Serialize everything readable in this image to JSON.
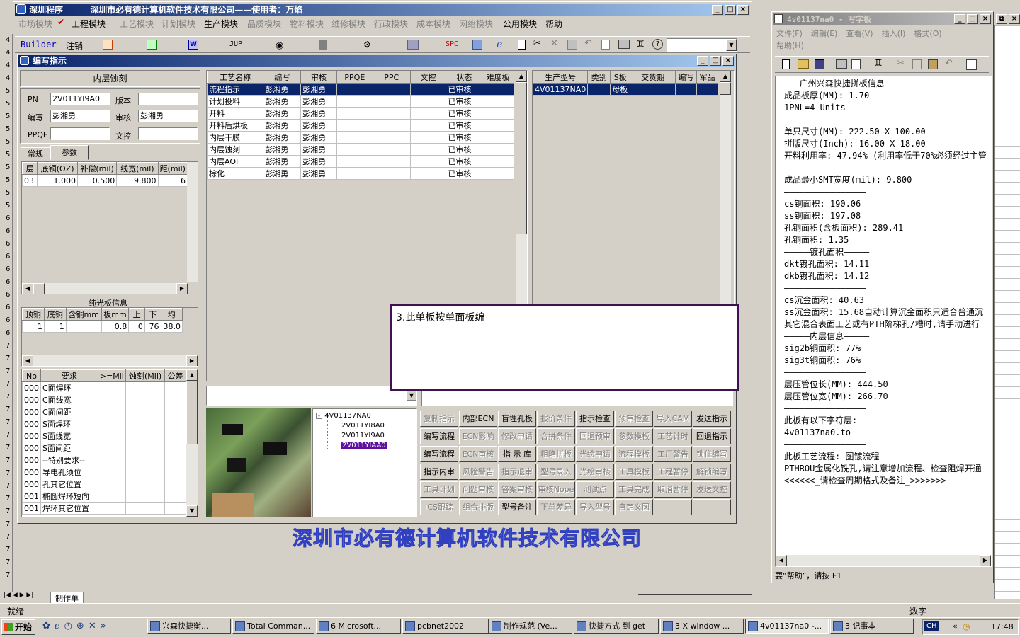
{
  "main_window": {
    "title_app": "深圳程序",
    "title_company": "深圳市必有德计算机软件技术有限公司——使用者：万焰",
    "menu": [
      "市场模块",
      "工程模块",
      "工艺模块",
      "计划模块",
      "生产模块",
      "品质模块",
      "物料模块",
      "维修模块",
      "行政模块",
      "成本模块",
      "网络模块",
      "公用模块",
      "帮助"
    ],
    "toolbar_builder": "Builder",
    "toolbar_logout": "注销",
    "toolbar_jup": "JUP",
    "toolbar_spc": "SPC",
    "watermark": "深圳市必有德计算机软件技术有限公司",
    "sheet_tab": "制作单",
    "status_left": "就绪",
    "status_right": "数字"
  },
  "dialog": {
    "title": "编写指示",
    "section_title": "内层蚀刻",
    "pn_label": "PN",
    "pn_value": "2V011YI9A0",
    "version_label": "版本",
    "version_value": "",
    "writer_label": "编写",
    "writer_value": "彭湘勇",
    "reviewer_label": "审核",
    "reviewer_value": "彭湘勇",
    "ppqe_label": "PPQE",
    "ppqe_value": "",
    "doc_label": "文控",
    "doc_value": "",
    "tab_normal": "常规",
    "tab_params": "参数",
    "layer_headers": [
      "层",
      "底铜(OZ)",
      "补偿(mil)",
      "线宽(mil)",
      "距(mil)"
    ],
    "layer_rows": [
      [
        "03",
        "1.000",
        "0.500",
        "9.800",
        "6"
      ]
    ],
    "bare_title": "纯光板信息",
    "bare_headers": [
      "顶铜",
      "底铜",
      "含铜mm",
      "板mm",
      "上",
      "下",
      "均"
    ],
    "bare_rows": [
      [
        "1",
        "1",
        "",
        "0.8",
        "0",
        "76",
        "38.0"
      ]
    ],
    "req_headers": [
      "No",
      "要求",
      ">=Mil",
      "蚀刻(Mil)",
      "公差"
    ],
    "req_rows": [
      [
        "000",
        "C面焊环"
      ],
      [
        "000",
        "C面线宽"
      ],
      [
        "000",
        "C面间距"
      ],
      [
        "000",
        "S面焊环"
      ],
      [
        "000",
        "S面线宽"
      ],
      [
        "000",
        "S面间距"
      ],
      [
        "000",
        "--特别要求--"
      ],
      [
        "000",
        "导电孔须位"
      ],
      [
        "000",
        "孔其它位置"
      ],
      [
        "001",
        "椭圆焊环短向"
      ],
      [
        "001",
        "焊环其它位置"
      ]
    ],
    "process_headers": [
      "工艺名称",
      "编写",
      "审核",
      "PPQE",
      "PPC",
      "文控",
      "状态",
      "难度板"
    ],
    "process_rows": [
      [
        "流程指示",
        "彭湘勇",
        "彭湘勇",
        "",
        "",
        "",
        "已审核",
        ""
      ],
      [
        "计划投料",
        "彭湘勇",
        "彭湘勇",
        "",
        "",
        "",
        "已审核",
        ""
      ],
      [
        "开料",
        "彭湘勇",
        "彭湘勇",
        "",
        "",
        "",
        "已审核",
        ""
      ],
      [
        "开料后烘板",
        "彭湘勇",
        "彭湘勇",
        "",
        "",
        "",
        "已审核",
        ""
      ],
      [
        "内层干膜",
        "彭湘勇",
        "彭湘勇",
        "",
        "",
        "",
        "已审核",
        ""
      ],
      [
        "内层蚀刻",
        "彭湘勇",
        "彭湘勇",
        "",
        "",
        "",
        "已审核",
        ""
      ],
      [
        "内层AOI",
        "彭湘勇",
        "彭湘勇",
        "",
        "",
        "",
        "已审核",
        ""
      ],
      [
        "棕化",
        "彭湘勇",
        "彭湘勇",
        "",
        "",
        "",
        "已审核",
        ""
      ]
    ],
    "model_headers": [
      "生产型号",
      "类别",
      "S板",
      "交货期",
      "编写",
      "军品"
    ],
    "model_rows": [
      [
        "4V01137NA0",
        "",
        "母板",
        "",
        "",
        ""
      ]
    ],
    "tree_root": "4V01137NA0",
    "tree_children": [
      "2V011YI8A0",
      "2V011YI9A0",
      "2V011YIAA0"
    ],
    "note_text": "3.此单板按单面板编",
    "buttons": [
      [
        "复制指示",
        "内部ECN",
        "盲埋孔板",
        "报价条件",
        "指示检查",
        "预审检查",
        "导入CAM",
        "发送指示"
      ],
      [
        "编写流程",
        "ECN影响",
        "修改申请",
        "合拼条件",
        "回退预审",
        "参数模板",
        "工艺计时",
        "回退指示"
      ],
      [
        "编写流程",
        "ECN审核",
        "指 示 库",
        "粗略拼板",
        "光绘申请",
        "流程模板",
        "工厂警告",
        "锁住编写"
      ],
      [
        "指示内审",
        "风险警告",
        "指示退审",
        "型号录入",
        "光绘审核",
        "工具模板",
        "工程暂停",
        "解锁编写"
      ],
      [
        "工具计划",
        "问题审核",
        "答案审核",
        "审核Nope",
        "测试点",
        "工具完成",
        "取消暂停",
        "发送文控"
      ],
      [
        "ICS跟踪",
        "组合排版",
        "型号备注",
        "下单差异",
        "导入型号",
        "自定义图",
        "",
        ""
      ]
    ],
    "buttons_enabled": [
      "内部ECN",
      "盲埋孔板",
      "指示检查",
      "发送指示",
      "编写流程",
      "回退指示",
      "指 示 库",
      "指示内审",
      "型号备注"
    ]
  },
  "notepad": {
    "title": "4v01137na0 - 写字板",
    "menu": [
      "文件(F)",
      "编辑(E)",
      "查看(V)",
      "插入(I)",
      "格式(O)",
      "帮助(H)"
    ],
    "lines": [
      "———广州兴森快捷拼板信息———",
      "成品板厚(MM): 1.70",
      "1PNL=4 Units",
      "————————————————",
      "单只尺寸(MM): 222.50 X 100.00",
      "拼版尺寸(Inch): 16.00 X 18.00",
      "开料利用率: 47.94% (利用率低于70%必须经过主管",
      "————————————————",
      "成品最小SMT宽度(mil): 9.800",
      "————————————————",
      "cs铜面积: 190.06",
      "ss铜面积: 197.08",
      "孔铜面积(含板面积): 289.41",
      "孔铜面积: 1.35",
      "—————镀孔面积—————",
      "dkt镀孔面积: 14.11",
      "dkb镀孔面积: 14.12",
      "————————————————",
      "cs沉金面积: 40.63",
      "ss沉金面积: 15.68自动计算沉金面积只适合普通沉",
      "其它混合表面工艺或有PTH阶梯孔/槽时,请手动进行",
      "—————内层信息—————",
      "sig2b铜面积: 77%",
      "sig3t铜面积: 76%",
      "————————————————",
      "层压管位长(MM): 444.50",
      "层压管位宽(MM): 266.70",
      "————————————————",
      "此板有以下字符层:",
      "4v01137na0.to",
      "————————————————",
      "此板工艺流程: 图镀流程",
      "PTHROU金属化铣孔,请注意增加流程、检查阻焊开通",
      "<<<<<<_请检查周期格式及备注_>>>>>>>"
    ],
    "status": "要“帮助”，请按 F1"
  },
  "taskbar": {
    "start": "开始",
    "items": [
      "兴森快捷衡...",
      "Total Comman...",
      "6 Microsoft...",
      "pcbnet2002",
      "制作规范 (Ve...",
      "快捷方式 到 get",
      "3 X window ...",
      "4v01137na0 -...",
      "3 记事本"
    ],
    "tray_ime": "CH",
    "clock": "17:48"
  }
}
